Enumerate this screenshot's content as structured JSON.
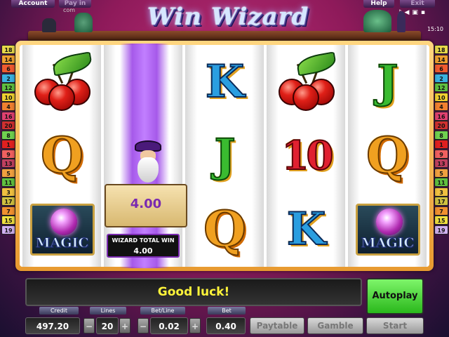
{
  "top_bar": {
    "account_label": "Account",
    "pay_in_label": "Pay in",
    "pay_in_sub": "com",
    "help_label": "Help",
    "exit_label": "Exit",
    "system_icons": [
      "music-note-icon",
      "speaker-icon",
      "window-icon",
      "fullscreen-icon"
    ],
    "clock": "15:10"
  },
  "logo": {
    "title": "Win Wizard"
  },
  "paylines": {
    "left": [
      "18",
      "14",
      "6",
      "2",
      "12",
      "10",
      "4",
      "16",
      "20",
      "8",
      "1",
      "9",
      "13",
      "5",
      "11",
      "3",
      "17",
      "7",
      "15",
      "19"
    ],
    "right": [
      "18",
      "14",
      "6",
      "2",
      "12",
      "10",
      "4",
      "16",
      "20",
      "8",
      "1",
      "9",
      "13",
      "5",
      "11",
      "3",
      "17",
      "7",
      "15",
      "19"
    ]
  },
  "reels": [
    [
      "cherry",
      "Q",
      "magic"
    ],
    [
      "wizard",
      "wizard",
      "wizard"
    ],
    [
      "K",
      "J",
      "Q"
    ],
    [
      "cherry",
      "10",
      "K"
    ],
    [
      "J",
      "Q",
      "magic"
    ]
  ],
  "symbols": {
    "K": "K",
    "Q": "Q",
    "J": "J",
    "ten": "10",
    "magic": "MAGIC"
  },
  "wizard_feature": {
    "scroll_value": "4.00",
    "total_label": "WIZARD TOTAL WIN",
    "total_value": "4.00"
  },
  "message": "Good luck!",
  "autoplay_label": "Autoplay",
  "controls": {
    "credit_label": "Credit",
    "credit_value": "497.20",
    "lines_label": "Lines",
    "lines_value": "20",
    "betline_label": "Bet/Line",
    "betline_value": "0.02",
    "bet_label": "Bet",
    "bet_value": "0.40",
    "minus": "−",
    "plus": "+",
    "paytable_label": "Paytable",
    "gamble_label": "Gamble",
    "start_label": "Start"
  },
  "colors": {
    "background": "#8e1a5a",
    "frame": "#f0b050",
    "message_text": "#fff43a",
    "autoplay": "#4ad83a",
    "wizard_beam": "#9a40e0"
  }
}
